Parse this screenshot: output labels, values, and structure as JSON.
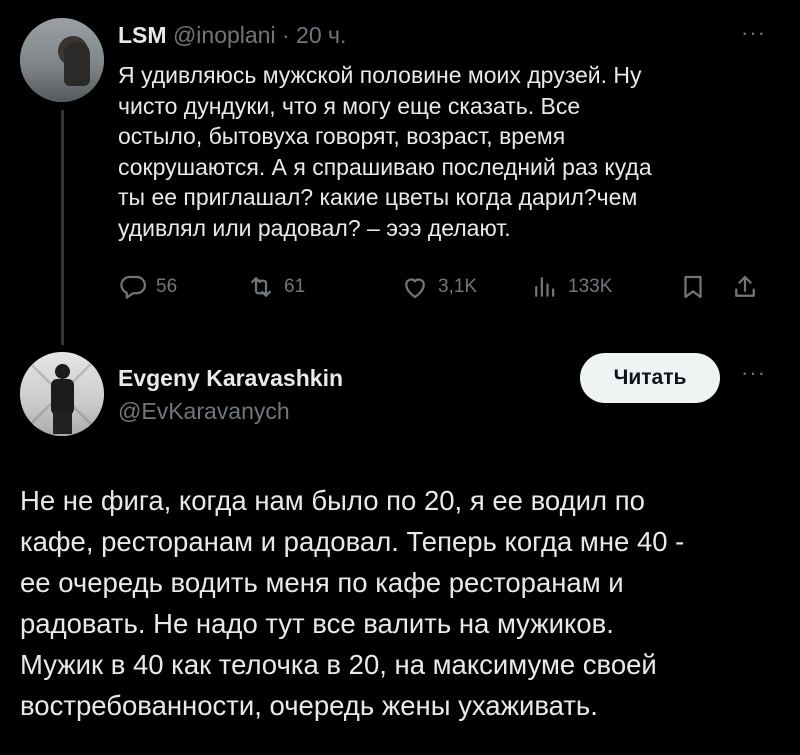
{
  "tweet1": {
    "name": "LSM",
    "handle": "@inoplani",
    "separator": "·",
    "time": "20 ч.",
    "more": "···",
    "text": "Я удивляюсь мужской половине моих друзей. Ну\nчисто дундуки, что я могу еще сказать. Все\nостыло, бытовуха говорят, возраст, время\nсокрушаются. А я спрашиваю последний раз куда\nты ее приглашал? какие цветы когда дарил?чем\nудивлял или радовал? – эээ делают.",
    "stats": {
      "replies": "56",
      "retweets": "61",
      "likes": "3,1K",
      "views": "133K"
    },
    "icons": [
      "reply-icon",
      "retweet-icon",
      "like-icon",
      "views-icon",
      "bookmark-icon",
      "share-icon"
    ]
  },
  "tweet2": {
    "name": "Evgeny Karavashkin",
    "handle": "@EvKaravanych",
    "follow_label": "Читать",
    "more": "···",
    "text": "Не не фига, когда нам было по 20, я ее водил по\nкафе, ресторанам и радовал. Теперь когда мне 40 -\nее очередь водить меня по кафе ресторанам и\nрадовать. Не надо тут все валить на мужиков.\nМужик в 40 как телочка в 20, на максимуме своей\nвостребованности, очередь жены ухаживать."
  },
  "colors": {
    "background": "#000000",
    "text": "#e7e9ea",
    "muted": "#71767b",
    "button": "#eff3f4"
  }
}
